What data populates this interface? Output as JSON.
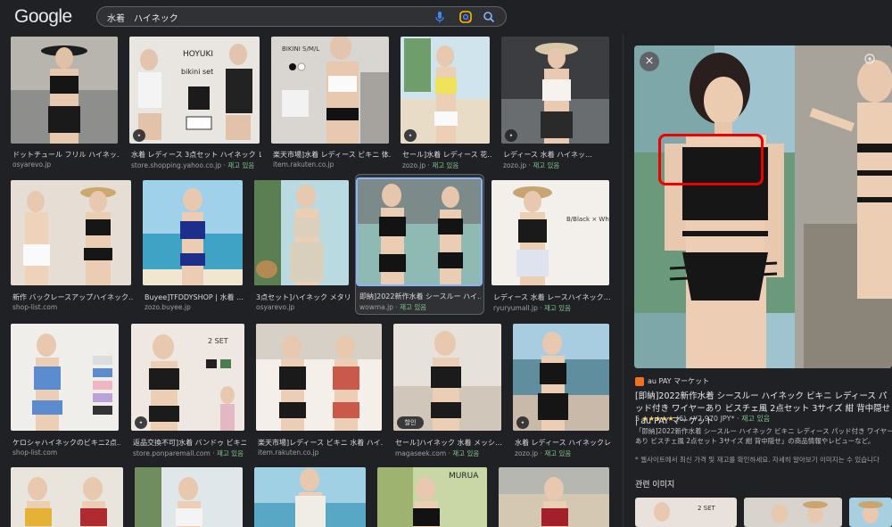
{
  "header": {
    "logo": "Google",
    "query": "水着　ハイネック"
  },
  "icons": {
    "mic": "microphone-icon",
    "lens": "google-lens-icon",
    "search": "search-icon",
    "close": "close-icon",
    "share": "share-icon",
    "store": "au-pay-store-icon",
    "tag": "product-tag-icon"
  },
  "colors": {
    "background": "#202124",
    "selection": "#8ab4f8",
    "highlight_box": "#ee0000",
    "green_text": "#81c995",
    "star": "#fdd663"
  },
  "results": [
    {
      "title": "ドットチュール フリル ハイネッ…",
      "source": "osyarevo.jp",
      "tag": ""
    },
    {
      "title": "水着 レディース 3点セット ハイネック レ…",
      "source": "store.shopping.yahoo.co.jp",
      "tag": "재고 있음"
    },
    {
      "title": "楽天市場]水着 レディース ビキニ 体…",
      "source": "item.rakuten.co.jp",
      "tag": ""
    },
    {
      "title": "セール]水着 レディース 花…",
      "source": "zozo.jp",
      "tag": "재고 있음"
    },
    {
      "title": "レディース 水着 ハイネッ…",
      "source": "zozo.jp",
      "tag": "재고 있음"
    },
    {
      "title": "新作 バックレースアップハイネック…",
      "source": "shop-list.com",
      "tag": ""
    },
    {
      "title": "Buyee]TFDDYSHOP | 水着 …",
      "source": "zozo.buyee.jp",
      "tag": ""
    },
    {
      "title": "3点セット]ハイネック メタリ…",
      "source": "osyarevo.jp",
      "tag": ""
    },
    {
      "title": "即納]2022新作水着 シースルー ハイ…",
      "source": "wowma.jp",
      "tag": "재고 있음"
    },
    {
      "title": "レディース 水着 レースハイネック…",
      "source": "ryuryumall.jp",
      "tag": "재고 있음"
    },
    {
      "title": "ケロシャハイネックのビキニ2点…",
      "source": "shop-list.com",
      "tag": ""
    },
    {
      "title": "返品交換不可]水着 バンドゥ ビキニ …",
      "source": "store.ponparemall.com",
      "tag": "재고 있음"
    },
    {
      "title": "楽天市場]レディース ビキニ 水着 ハイ…",
      "source": "item.rakuten.co.jp",
      "tag": ""
    },
    {
      "title": "セール]ハイネック 水着 メッシ…",
      "source": "magaseek.com",
      "tag": "재고 있음"
    },
    {
      "title": "水着 レディース ハイネックレ…",
      "source": "zozo.jp",
      "tag": "재고 있음"
    },
    {
      "title": "",
      "source": "",
      "tag": ""
    },
    {
      "title": "",
      "source": "",
      "tag": ""
    },
    {
      "title": "",
      "source": "",
      "tag": ""
    },
    {
      "title": "",
      "source": "",
      "tag": ""
    },
    {
      "title": "",
      "source": "",
      "tag": ""
    }
  ],
  "overlay_badge": {
    "sale": "할인"
  },
  "image_texts": {
    "bikini_set": "bikini set",
    "hoyuki": "HOYUKI",
    "bikini_sml": "BIKINI S/M/L",
    "blackwhite": "B/Black × White",
    "set2": "2 SET",
    "murua": "MURUA"
  },
  "panel": {
    "store": "au PAY マーケット",
    "title": "[即納]2022新作水着 シースルー ハイネック ビキニ レディース パッド付き ワイヤーあり ビスチェ風 2点セット 3サイズ 紺 背中隠せ | au PAY マーケット",
    "stars": "★★★★★",
    "rating_value": "5",
    "review_count": "(6)",
    "price": "¥2,970 JPY*",
    "stock": "재고 있음",
    "desc": "「即納]2022新作水着 シースルー ハイネック ビキニ レディース パッド付き ワイヤーあり ビスチェ風 2点セット 3サイズ 紺 背中隠せ」の商品情報やレビューなど。",
    "note": "* 웹사이트에서 최신 가격 및 재고를 확인하세요. 자세히 알아보기 이미지는 수 있습니다",
    "related": "관련 이미지"
  }
}
